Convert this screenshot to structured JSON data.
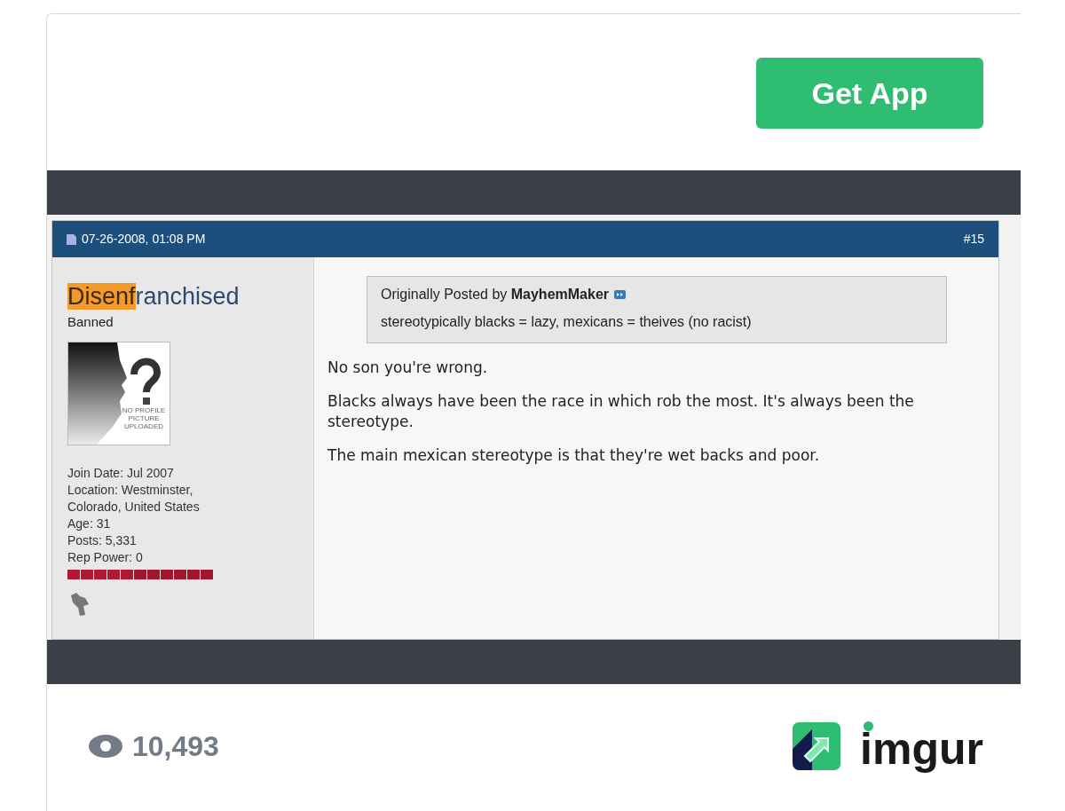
{
  "get_app_button": "Get App",
  "post": {
    "date": "07-26-2008, 01:08 PM",
    "number": "#15",
    "username_parts": [
      {
        "text": "Disenf",
        "highlighted": true
      },
      {
        "text": "ranchised",
        "highlighted": false
      }
    ],
    "user_title": "Banned",
    "avatar_caption": "NO PROFILE PICTURE UPLOADED",
    "user_info": [
      "Join Date: Jul 2007",
      "Location: Westminster, Colorado, United States",
      "Age: 31",
      "Posts: 5,331",
      "Rep Power: 0"
    ],
    "quote": {
      "prefix": "Originally Posted by",
      "author": "MayhemMaker",
      "text": "stereotypically blacks = lazy, mexicans = theives (no racist)"
    },
    "paragraphs": [
      "No son you're wrong.",
      "Blacks always have been the race in which rob the most. It's always been the stereotype.",
      "The main mexican stereotype is that they're wet backs and poor."
    ]
  },
  "views": "10,493",
  "logo_text": "imgur"
}
